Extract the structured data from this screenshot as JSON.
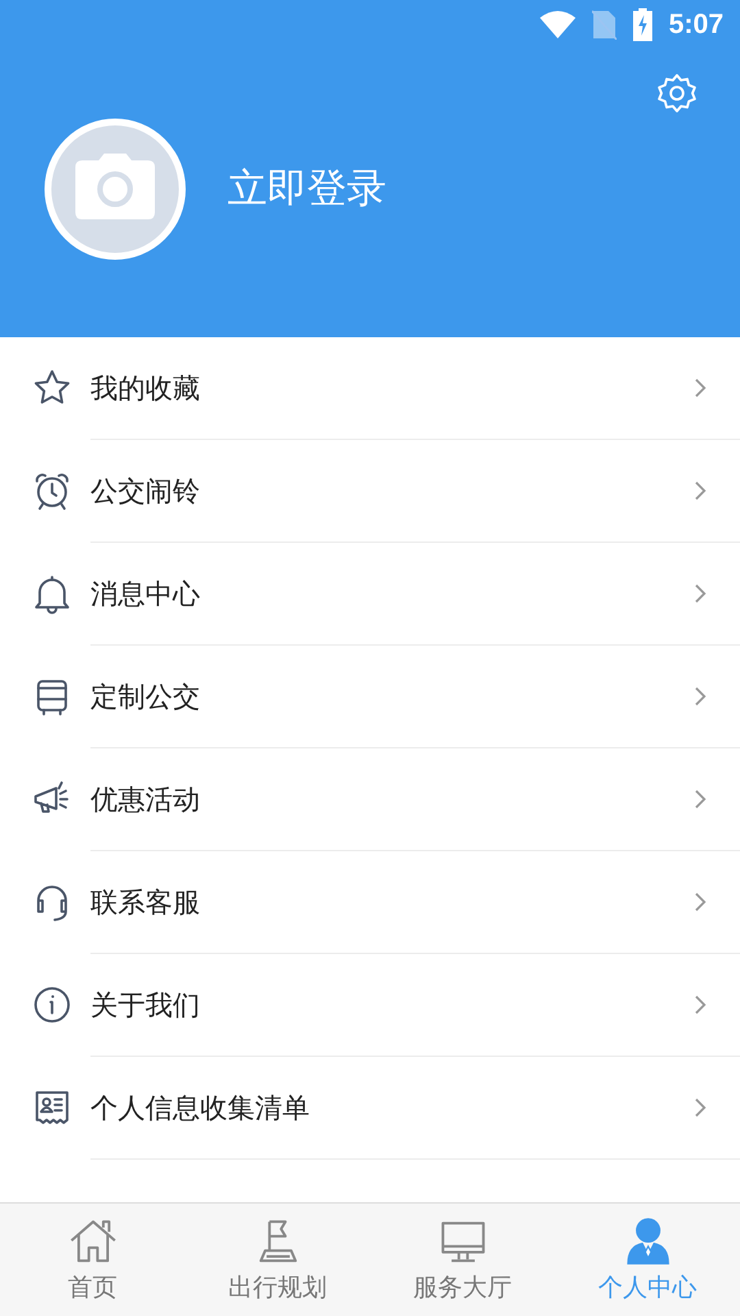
{
  "status_bar": {
    "time": "5:07"
  },
  "header": {
    "login_label": "立即登录"
  },
  "menu": [
    {
      "label": "我的收藏",
      "kind": "star"
    },
    {
      "label": "公交闹铃",
      "kind": "alarm"
    },
    {
      "label": "消息中心",
      "kind": "bell"
    },
    {
      "label": "定制公交",
      "kind": "bus"
    },
    {
      "label": "优惠活动",
      "kind": "megaphone"
    },
    {
      "label": "联系客服",
      "kind": "headset"
    },
    {
      "label": "关于我们",
      "kind": "info"
    },
    {
      "label": "个人信息收集清单",
      "kind": "idcard"
    }
  ],
  "tabs": [
    {
      "label": "首页",
      "kind": "home",
      "selected": false
    },
    {
      "label": "出行规划",
      "kind": "flag",
      "selected": false
    },
    {
      "label": "服务大厅",
      "kind": "monitor",
      "selected": false
    },
    {
      "label": "个人中心",
      "kind": "person",
      "selected": true
    }
  ]
}
